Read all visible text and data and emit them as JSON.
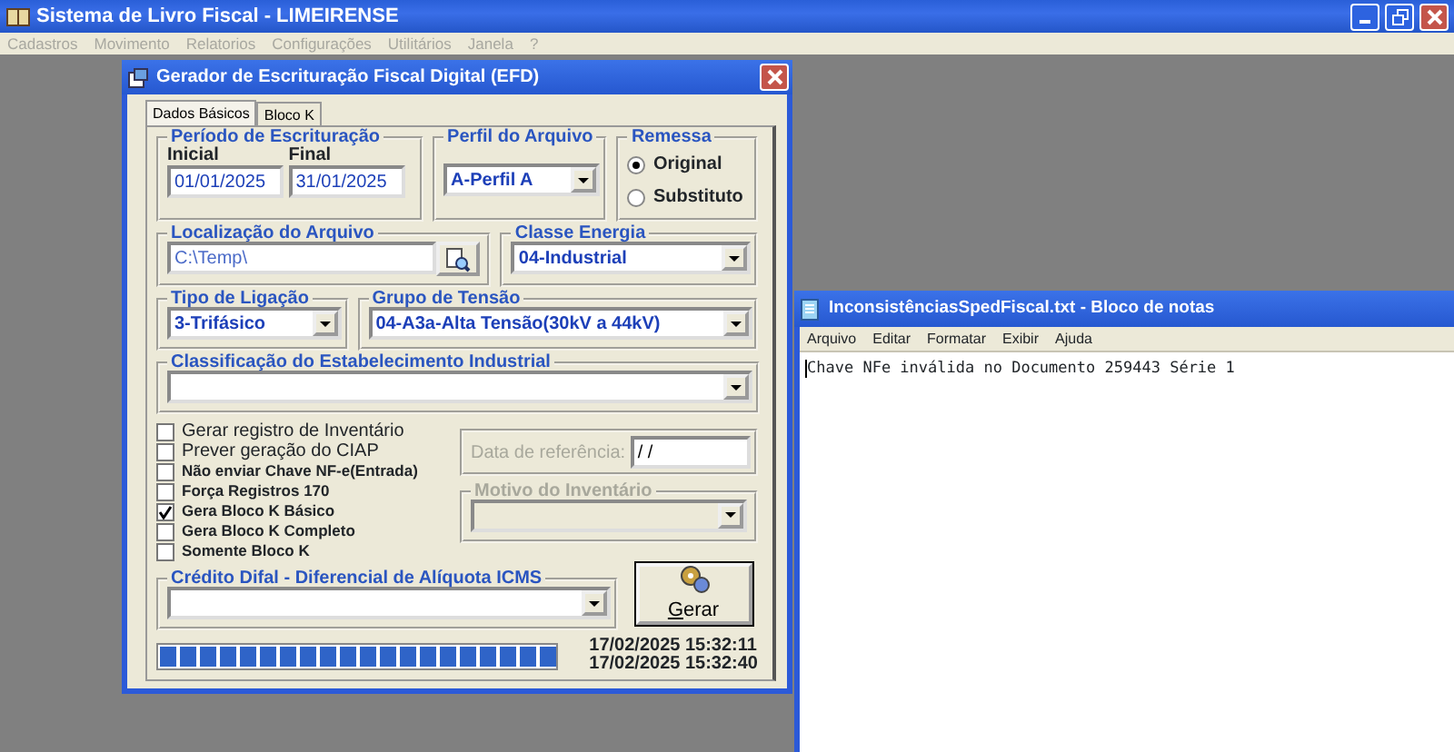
{
  "app": {
    "title": "Sistema de Livro Fiscal - LIMEIRENSE",
    "menu": [
      "Cadastros",
      "Movimento",
      "Relatorios",
      "Configurações",
      "Utilitários",
      "Janela",
      "?"
    ]
  },
  "dialog": {
    "title": "Gerador de Escrituração Fiscal Digital (EFD)",
    "tabs": [
      {
        "label": "Dados Básicos",
        "selected": true
      },
      {
        "label": "Bloco K",
        "selected": false
      }
    ],
    "periodo": {
      "legend": "Período de Escrituração",
      "inicial_label": "Inicial",
      "inicial_value": "01/01/2025",
      "final_label": "Final",
      "final_value": "31/01/2025"
    },
    "perfil": {
      "legend": "Perfil do Arquivo",
      "value": "A-Perfil A"
    },
    "remessa": {
      "legend": "Remessa",
      "options": [
        {
          "label": "Original",
          "selected": true
        },
        {
          "label": "Substituto",
          "selected": false
        }
      ]
    },
    "localizacao": {
      "legend": "Localização do Arquivo",
      "value": "C:\\Temp\\"
    },
    "classe_energia": {
      "legend": "Classe Energia",
      "value": "04-Industrial"
    },
    "tipo_ligacao": {
      "legend": "Tipo de Ligação",
      "value": "3-Trifásico"
    },
    "grupo_tensao": {
      "legend": "Grupo de Tensão",
      "value": "04-A3a-Alta Tensão(30kV a 44kV)"
    },
    "classificacao": {
      "legend": "Classificação do Estabelecimento Industrial"
    },
    "checkboxes": [
      {
        "label": "Gerar registro de Inventário",
        "checked": false,
        "kind": "large"
      },
      {
        "label": "Prever geração do CIAP",
        "checked": false,
        "kind": "large"
      },
      {
        "label": "Não enviar Chave NF-e(Entrada)",
        "checked": false,
        "kind": "small"
      },
      {
        "label": "Força Registros 170",
        "checked": false,
        "kind": "small"
      },
      {
        "label": "Gera Bloco K Básico",
        "checked": true,
        "kind": "small"
      },
      {
        "label": "Gera Bloco K Completo",
        "checked": false,
        "kind": "small"
      },
      {
        "label": "Somente Bloco K",
        "checked": false,
        "kind": "small"
      }
    ],
    "data_referencia": {
      "label": "Data de referência:",
      "value": " / /",
      "disabled": true
    },
    "motivo": {
      "legend": "Motivo do Inventário",
      "disabled": true
    },
    "credito_difal": {
      "legend": "Crédito Difal - Diferencial de Alíquota ICMS"
    },
    "gerar_button": {
      "label": "Gerar"
    },
    "progress": {
      "level": 1
    },
    "timestamps": [
      "17/02/2025 15:32:11",
      "17/02/2025 15:32:40"
    ]
  },
  "notepad": {
    "title": "InconsistênciasSpedFiscal.txt - Bloco de notas",
    "menu": [
      "Arquivo",
      "Editar",
      "Formatar",
      "Exibir",
      "Ajuda"
    ],
    "text": "Chave NFe inválida no Documento 259443 Série 1"
  }
}
